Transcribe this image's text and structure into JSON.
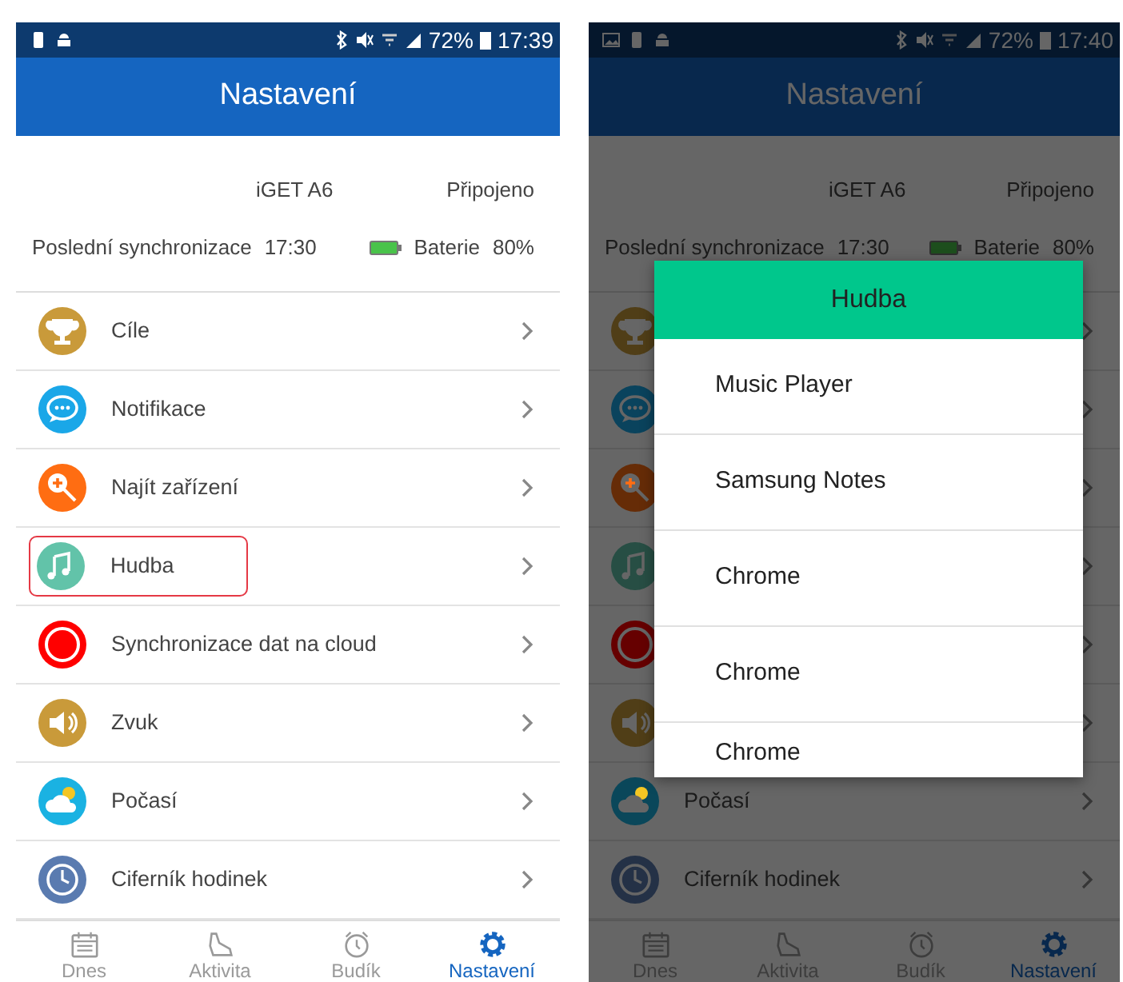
{
  "screens": [
    {
      "status_bar": {
        "battery": "72%",
        "time": "17:39"
      },
      "title": "Nastavení",
      "device": {
        "name": "iGET A6",
        "connection": "Připojeno",
        "sync_label": "Poslední synchronizace",
        "sync_time": "17:30",
        "battery_label": "Baterie",
        "battery_value": "80%"
      },
      "menu": [
        {
          "label": "Cíle",
          "color": "#c99a3a",
          "highlighted": false
        },
        {
          "label": "Notifikace",
          "color": "#1aa7e8",
          "highlighted": false
        },
        {
          "label": "Najít zařízení",
          "color": "#ff6d12",
          "highlighted": false
        },
        {
          "label": "Hudba",
          "color": "#62c3a9",
          "highlighted": true
        },
        {
          "label": "Synchronizace dat na cloud",
          "color": "#ff0000",
          "highlighted": false
        },
        {
          "label": "Zvuk",
          "color": "#c99a3a",
          "highlighted": false
        },
        {
          "label": "Počasí",
          "color": "#1ab2e2",
          "highlighted": false
        },
        {
          "label": "Ciferník hodinek",
          "color": "#5a7bb0",
          "highlighted": false
        }
      ],
      "tabs": [
        {
          "label": "Dnes",
          "selected": false
        },
        {
          "label": "Aktivita",
          "selected": false
        },
        {
          "label": "Budík",
          "selected": false
        },
        {
          "label": "Nastavení",
          "selected": true
        }
      ]
    },
    {
      "status_bar": {
        "battery": "72%",
        "time": "17:40"
      },
      "title": "Nastavení",
      "device": {
        "name": "iGET A6",
        "connection": "Připojeno",
        "sync_label": "Poslední synchronizace",
        "sync_time": "17:30",
        "battery_label": "Baterie",
        "battery_value": "80%"
      },
      "menu": [
        {
          "color": "#503e17",
          "highlighted": false
        },
        {
          "color": "#0a435d",
          "highlighted": false
        },
        {
          "color": "#662c07",
          "highlighted": false
        },
        {
          "color": "#274e44",
          "highlighted": false
        },
        {
          "color": "#660000",
          "highlighted": false
        },
        {
          "color": "#503e17",
          "highlighted": false
        },
        {
          "label": "Počasí",
          "color": "#0a475a",
          "highlighted": false
        },
        {
          "label": "Ciferník hodinek",
          "color": "#243146",
          "highlighted": false
        }
      ],
      "tabs": [
        {
          "label": "Dnes",
          "selected": false
        },
        {
          "label": "Aktivita",
          "selected": false
        },
        {
          "label": "Budík",
          "selected": false
        },
        {
          "label": "Nastavení",
          "selected": true
        }
      ],
      "dialog": {
        "title": "Hudba",
        "options": [
          "Music Player",
          "Samsung Notes",
          "Chrome",
          "Chrome",
          "Chrome"
        ]
      }
    }
  ]
}
